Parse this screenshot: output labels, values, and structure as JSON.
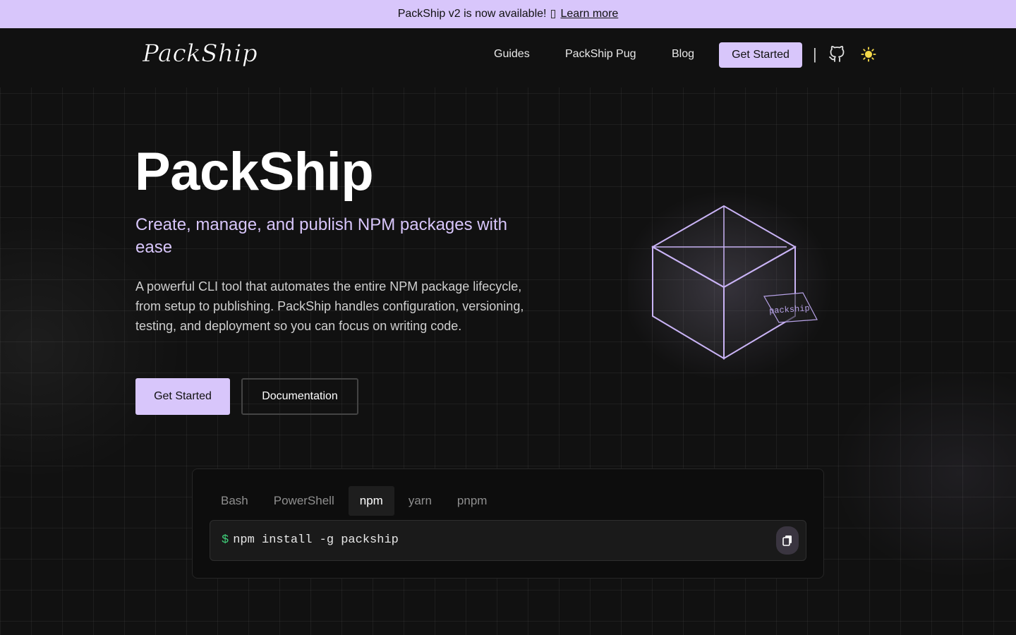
{
  "banner": {
    "text": "PackShip v2 is now available!",
    "link": "Learn more"
  },
  "nav": {
    "logo": "PackShip",
    "links": [
      "Guides",
      "PackShip Pug",
      "Blog"
    ],
    "cta": "Get Started",
    "separator": "|",
    "icons": [
      "github-icon",
      "sun-icon"
    ]
  },
  "hero": {
    "title": "PackShip",
    "subtitle": "Create, manage, and publish NPM packages with ease",
    "description": "A powerful CLI tool that automates the entire NPM package lifecycle, from setup to publishing. PackShip handles configuration, versioning, testing, and deployment so you can focus on writing code.",
    "primary_button": "Get Started",
    "secondary_button": "Documentation",
    "illustration_label": "packship"
  },
  "install": {
    "tabs": [
      "Bash",
      "PowerShell",
      "npm",
      "yarn",
      "pnpm"
    ],
    "active_tab": "npm",
    "prompt": "$",
    "command": "npm install -g packship",
    "copy_icon": "copy-icon"
  },
  "colors": {
    "accent": "#d8c6fb",
    "background": "#111111",
    "prompt": "#3fd07a",
    "sun": "#f5d94a"
  }
}
